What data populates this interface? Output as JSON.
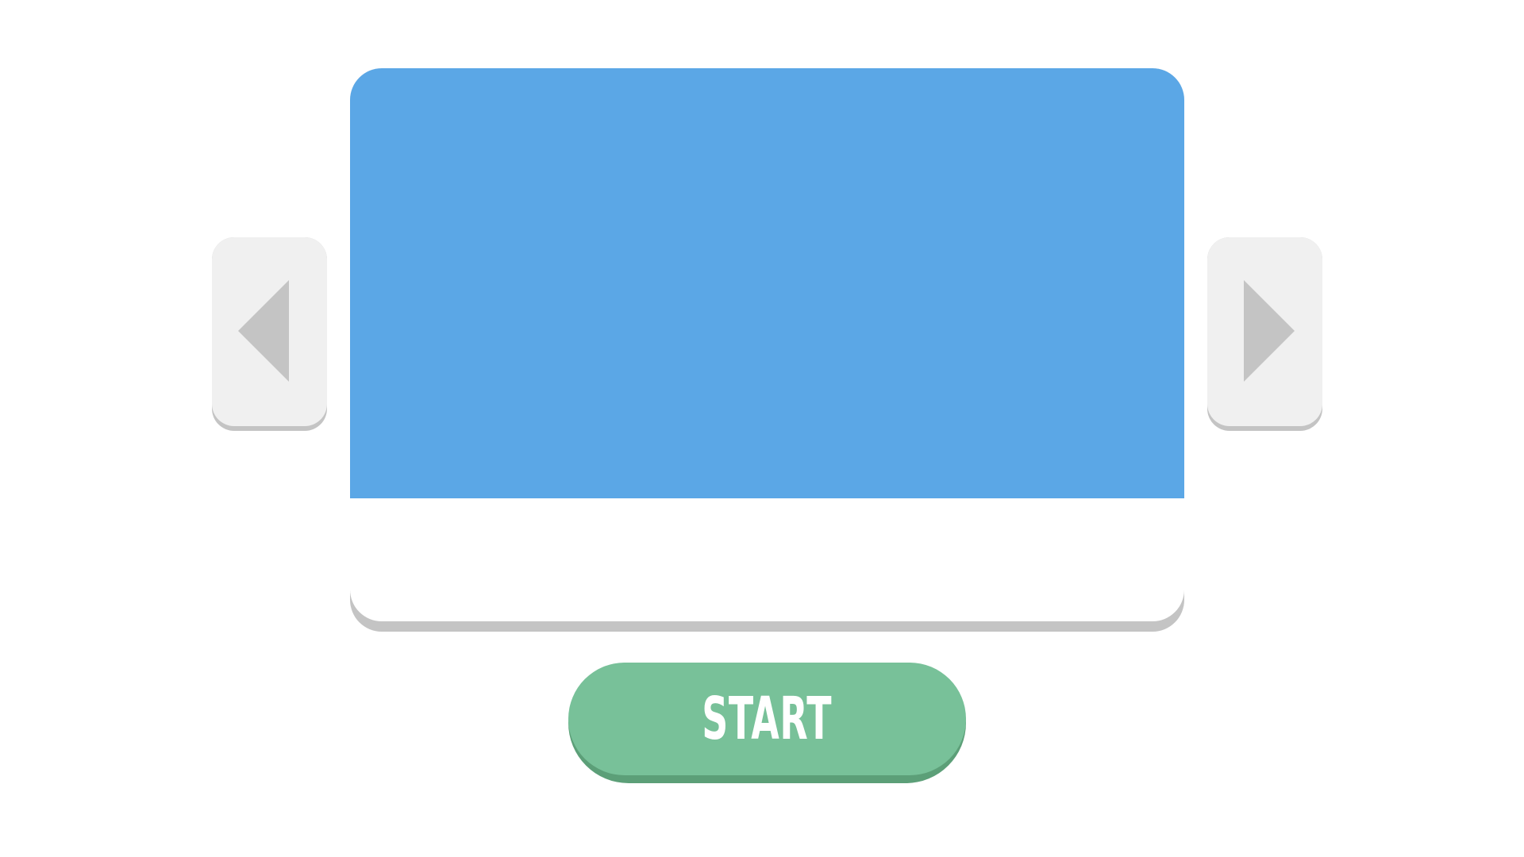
{
  "theme": {
    "background": "#ffffff",
    "card": "#ffffff",
    "card_shadow": "#c4c4c4",
    "preview": "#5ba7e6",
    "nav_button": "#f0f0f0",
    "nav_shadow": "#c4c4c4",
    "arrow": "#c4c4c4",
    "start_button": "#78c199",
    "start_shadow": "#5c9f78",
    "text_on_button": "#ffffff"
  },
  "level_card": {
    "caption": ""
  },
  "navigation": {
    "prev_icon": "triangle-left-icon",
    "next_icon": "triangle-right-icon"
  },
  "start_button": {
    "label": "START"
  }
}
